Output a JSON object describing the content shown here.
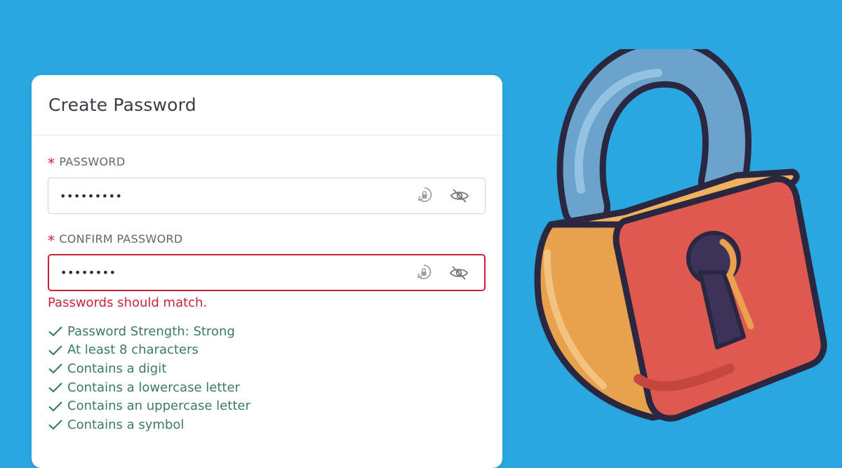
{
  "card": {
    "title": "Create Password",
    "password": {
      "label": "PASSWORD",
      "required_mark": "*",
      "value": "•••••••••"
    },
    "confirm": {
      "label": "CONFIRM PASSWORD",
      "required_mark": "*",
      "value": "••••••••",
      "error": "Passwords should match."
    },
    "checks": [
      "Password Strength: Strong",
      "At least 8 characters",
      "Contains a digit",
      "Contains a lowercase letter",
      "Contains an uppercase letter",
      "Contains a symbol"
    ]
  },
  "icons": {
    "password_manager": "password-manager-icon",
    "visibility_toggle": "eye-slash-icon",
    "check": "check-icon",
    "illustration": "padlock-icon"
  },
  "colors": {
    "background": "#28a7e1",
    "error": "#c8243a",
    "success": "#3b7a6a",
    "required": "#d2203b"
  }
}
